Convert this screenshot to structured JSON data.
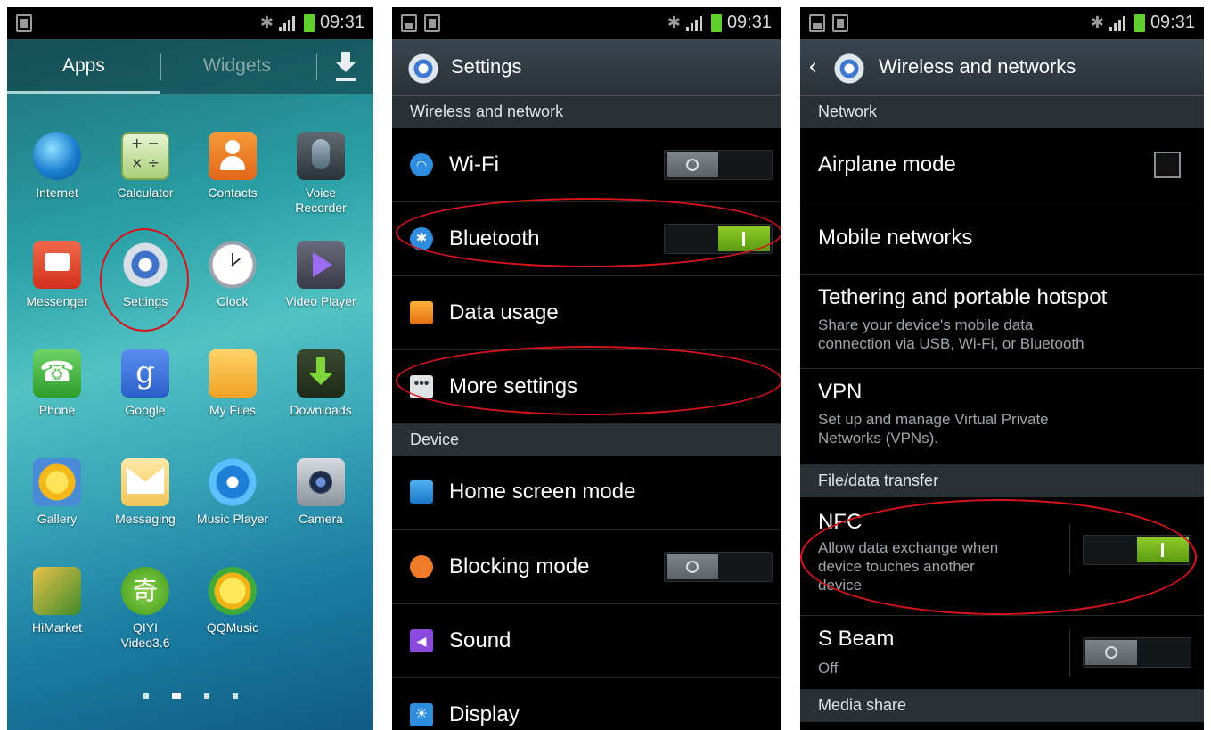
{
  "status": {
    "time": "09:31"
  },
  "home": {
    "tabs": {
      "apps": "Apps",
      "widgets": "Widgets"
    },
    "apps": [
      {
        "label": "Internet",
        "icon": "globe-icon"
      },
      {
        "label": "Calculator",
        "icon": "calculator-icon",
        "glyph": "+ −\n× ÷"
      },
      {
        "label": "Contacts",
        "icon": "contacts-icon"
      },
      {
        "label": "Voice\nRecorder",
        "icon": "microphone-icon"
      },
      {
        "label": "Messenger",
        "icon": "messenger-icon"
      },
      {
        "label": "Settings",
        "icon": "settings-gear-icon"
      },
      {
        "label": "Clock",
        "icon": "clock-icon"
      },
      {
        "label": "Video Player",
        "icon": "video-player-icon"
      },
      {
        "label": "Phone",
        "icon": "phone-icon"
      },
      {
        "label": "Google",
        "icon": "google-icon",
        "glyph": "g"
      },
      {
        "label": "My Files",
        "icon": "folder-icon"
      },
      {
        "label": "Downloads",
        "icon": "download-icon"
      },
      {
        "label": "Gallery",
        "icon": "gallery-icon"
      },
      {
        "label": "Messaging",
        "icon": "envelope-icon"
      },
      {
        "label": "Music Player",
        "icon": "music-player-icon"
      },
      {
        "label": "Camera",
        "icon": "camera-icon"
      },
      {
        "label": "HiMarket",
        "icon": "himarket-icon"
      },
      {
        "label": "QIYI\nVideo3.6",
        "icon": "qiyi-icon",
        "glyph": "奇"
      },
      {
        "label": "QQMusic",
        "icon": "qqmusic-icon"
      }
    ]
  },
  "settings": {
    "title": "Settings",
    "sections": {
      "wireless": "Wireless and network",
      "device": "Device"
    },
    "items": {
      "wifi": "Wi-Fi",
      "bluetooth": "Bluetooth",
      "data_usage": "Data usage",
      "more_settings": "More settings",
      "home_screen_mode": "Home screen mode",
      "blocking_mode": "Blocking mode",
      "sound": "Sound",
      "display": "Display"
    },
    "toggles": {
      "wifi": false,
      "bluetooth": true,
      "blocking_mode": false
    }
  },
  "wireless": {
    "title": "Wireless and networks",
    "sections": {
      "network": "Network",
      "file_transfer": "File/data transfer",
      "media_share": "Media share"
    },
    "items": {
      "airplane": "Airplane mode",
      "mobile_networks": "Mobile networks",
      "tethering": "Tethering and portable hotspot",
      "tethering_sub": "Share your device's mobile data\nconnection via USB, Wi-Fi, or Bluetooth",
      "vpn": "VPN",
      "vpn_sub": "Set up and manage Virtual Private\nNetworks (VPNs).",
      "nfc": "NFC",
      "nfc_sub": "Allow data exchange when\ndevice touches another\ndevice",
      "sbeam": "S Beam",
      "sbeam_sub": "Off"
    },
    "toggles": {
      "airplane": false,
      "nfc": true,
      "sbeam": false
    }
  },
  "colors": {
    "highlight": "#d8141b",
    "toggle_on": "#7fbf1e",
    "status_battery": "#5fd02c"
  }
}
